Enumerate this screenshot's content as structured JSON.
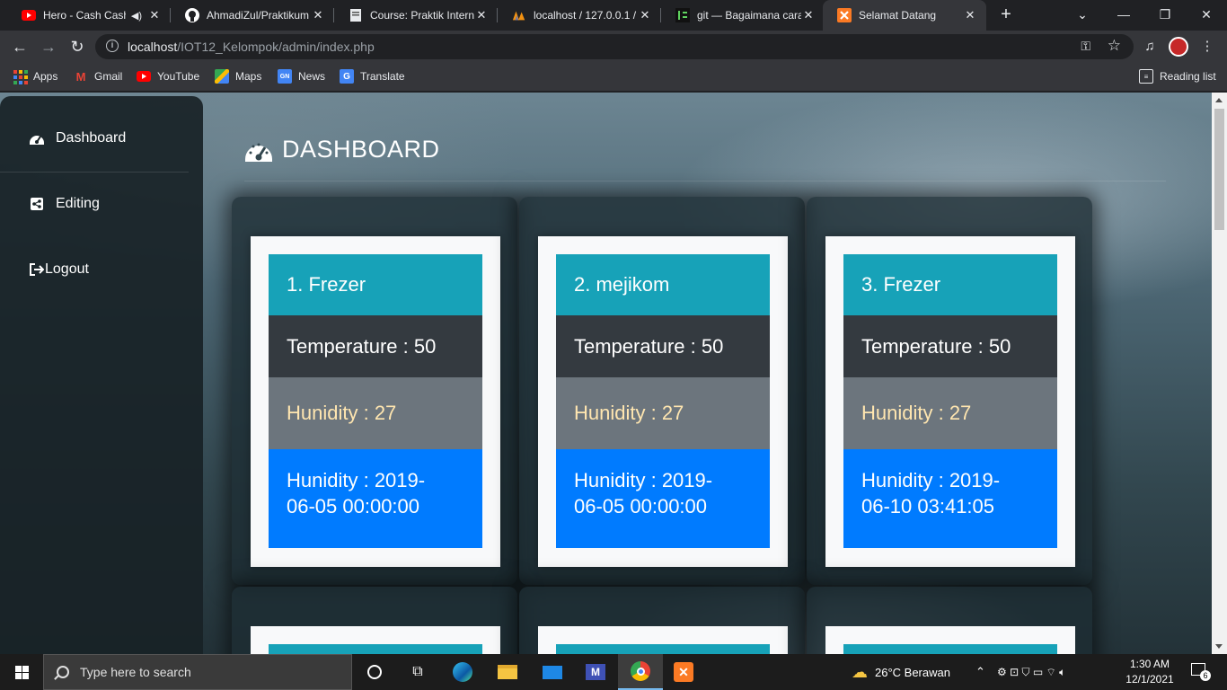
{
  "browser": {
    "tabs": [
      {
        "title": "Hero - Cash Cash",
        "favicon": "youtube-icon",
        "audio": true
      },
      {
        "title": "AhmadiZul/Praktikum",
        "favicon": "github-icon"
      },
      {
        "title": "Course: Praktik Interne",
        "favicon": "moodle-icon"
      },
      {
        "title": "localhost / 127.0.0.1 /",
        "favicon": "phpmyadmin-icon"
      },
      {
        "title": "git — Bagaimana cara",
        "favicon": "stackoverflow-icon"
      },
      {
        "title": "Selamat Datang",
        "favicon": "xampp-icon",
        "active": true
      }
    ],
    "url_host": "localhost",
    "url_path": "/IOT12_Kelompok/admin/index.php",
    "bookmarks": [
      {
        "label": "Apps",
        "icon": "apps-grid-icon"
      },
      {
        "label": "Gmail",
        "icon": "gmail-icon"
      },
      {
        "label": "YouTube",
        "icon": "youtube-icon"
      },
      {
        "label": "Maps",
        "icon": "maps-icon"
      },
      {
        "label": "News",
        "icon": "news-icon"
      },
      {
        "label": "Translate",
        "icon": "translate-icon"
      }
    ],
    "reading_list": "Reading list"
  },
  "sidebar": {
    "items": [
      {
        "label": "Dashboard",
        "icon": "tachometer-icon"
      },
      {
        "label": "Editing",
        "icon": "share-square-icon"
      },
      {
        "label": "Logout",
        "icon": "sign-out-icon"
      }
    ]
  },
  "page": {
    "title": "DASHBOARD"
  },
  "devices": [
    {
      "name": "1. Frezer",
      "temperature": "Temperature : 50",
      "humidity": "Hunidity : 27",
      "time_line1": "Hunidity : 2019-",
      "time_line2": "06-05 00:00:00"
    },
    {
      "name": "2. mejikom",
      "temperature": "Temperature : 50",
      "humidity": "Hunidity : 27",
      "time_line1": "Hunidity : 2019-",
      "time_line2": "06-05 00:00:00"
    },
    {
      "name": "3. Frezer",
      "temperature": "Temperature : 50",
      "humidity": "Hunidity : 27",
      "time_line1": "Hunidity : 2019-",
      "time_line2": "06-10 03:41:05"
    }
  ],
  "colors": {
    "card_header": "#17a2b8",
    "card_temp": "#343a40",
    "card_humidity": "#6c757d",
    "card_time": "#007bff"
  },
  "taskbar": {
    "search_placeholder": "Type here to search",
    "weather": "26°C  Berawan",
    "time": "1:30 AM",
    "date": "12/1/2021",
    "notifications": "6"
  }
}
